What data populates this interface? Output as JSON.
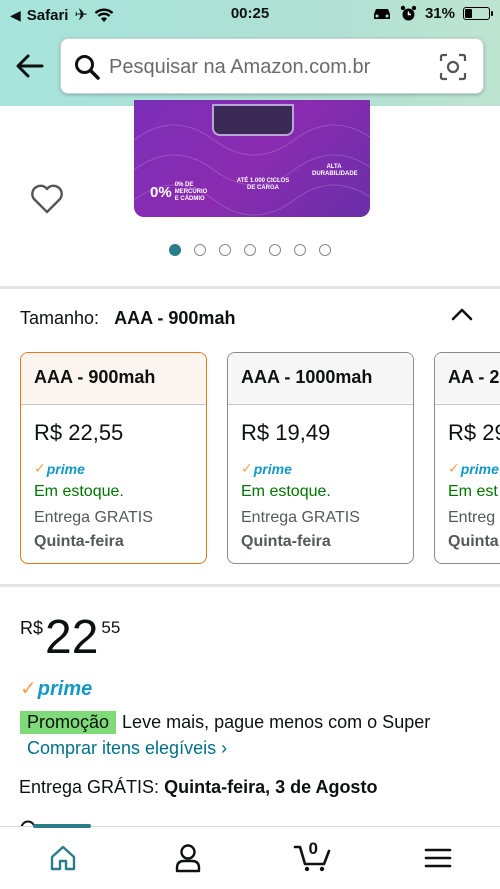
{
  "status_bar": {
    "carrier": "Safari",
    "time": "00:25",
    "battery": "31%",
    "battery_level": 0.31
  },
  "search": {
    "placeholder": "Pesquisar na Amazon.com.br"
  },
  "product_image": {
    "label_mercury": "0% DE MERCÚRIO E CÁDMIO",
    "label_cycles": "ATÉ 1.000 CICLOS DE CARGA",
    "label_durability": "ALTA DURABILIDADE",
    "carousel_count": 7,
    "carousel_active": 0
  },
  "size_selector": {
    "label": "Tamanho:",
    "selected": "AAA - 900mah",
    "options": [
      {
        "title": "AAA - 900mah",
        "price": "R$ 22,55",
        "prime": "prime",
        "stock": "Em estoque.",
        "shipping": "Entrega GRATIS",
        "day": "Quinta-feira"
      },
      {
        "title": "AAA - 1000mah",
        "price": "R$ 19,49",
        "prime": "prime",
        "stock": "Em estoque.",
        "shipping": "Entrega GRATIS",
        "day": "Quinta-feira"
      },
      {
        "title": "AA - 2",
        "price": "R$ 29",
        "prime": "prime",
        "stock": "Em est",
        "shipping": "Entreg",
        "day": "Quinta"
      }
    ]
  },
  "price": {
    "currency": "R$",
    "integer": "22",
    "cents": "55"
  },
  "prime_label": "prime",
  "promotion": {
    "badge": "Promoção",
    "text": "Leve mais, pague menos com o Super",
    "link": "Comprar itens elegíveis ›"
  },
  "delivery": {
    "prefix": "Entrega GRÁTIS:",
    "date": "Quinta-feira, 3 de Agosto"
  },
  "colors": {
    "accent": "#2b7d8a",
    "selected_border": "#e47911",
    "in_stock": "#007600",
    "link": "#007185",
    "promo_badge": "#7fda7a",
    "prime_blue": "#1399c6",
    "header_gradient": "#a6e4dc"
  },
  "bottom_nav": {
    "cart_count": "0",
    "items": [
      "home-icon",
      "account-icon",
      "cart-icon",
      "menu-icon"
    ]
  }
}
